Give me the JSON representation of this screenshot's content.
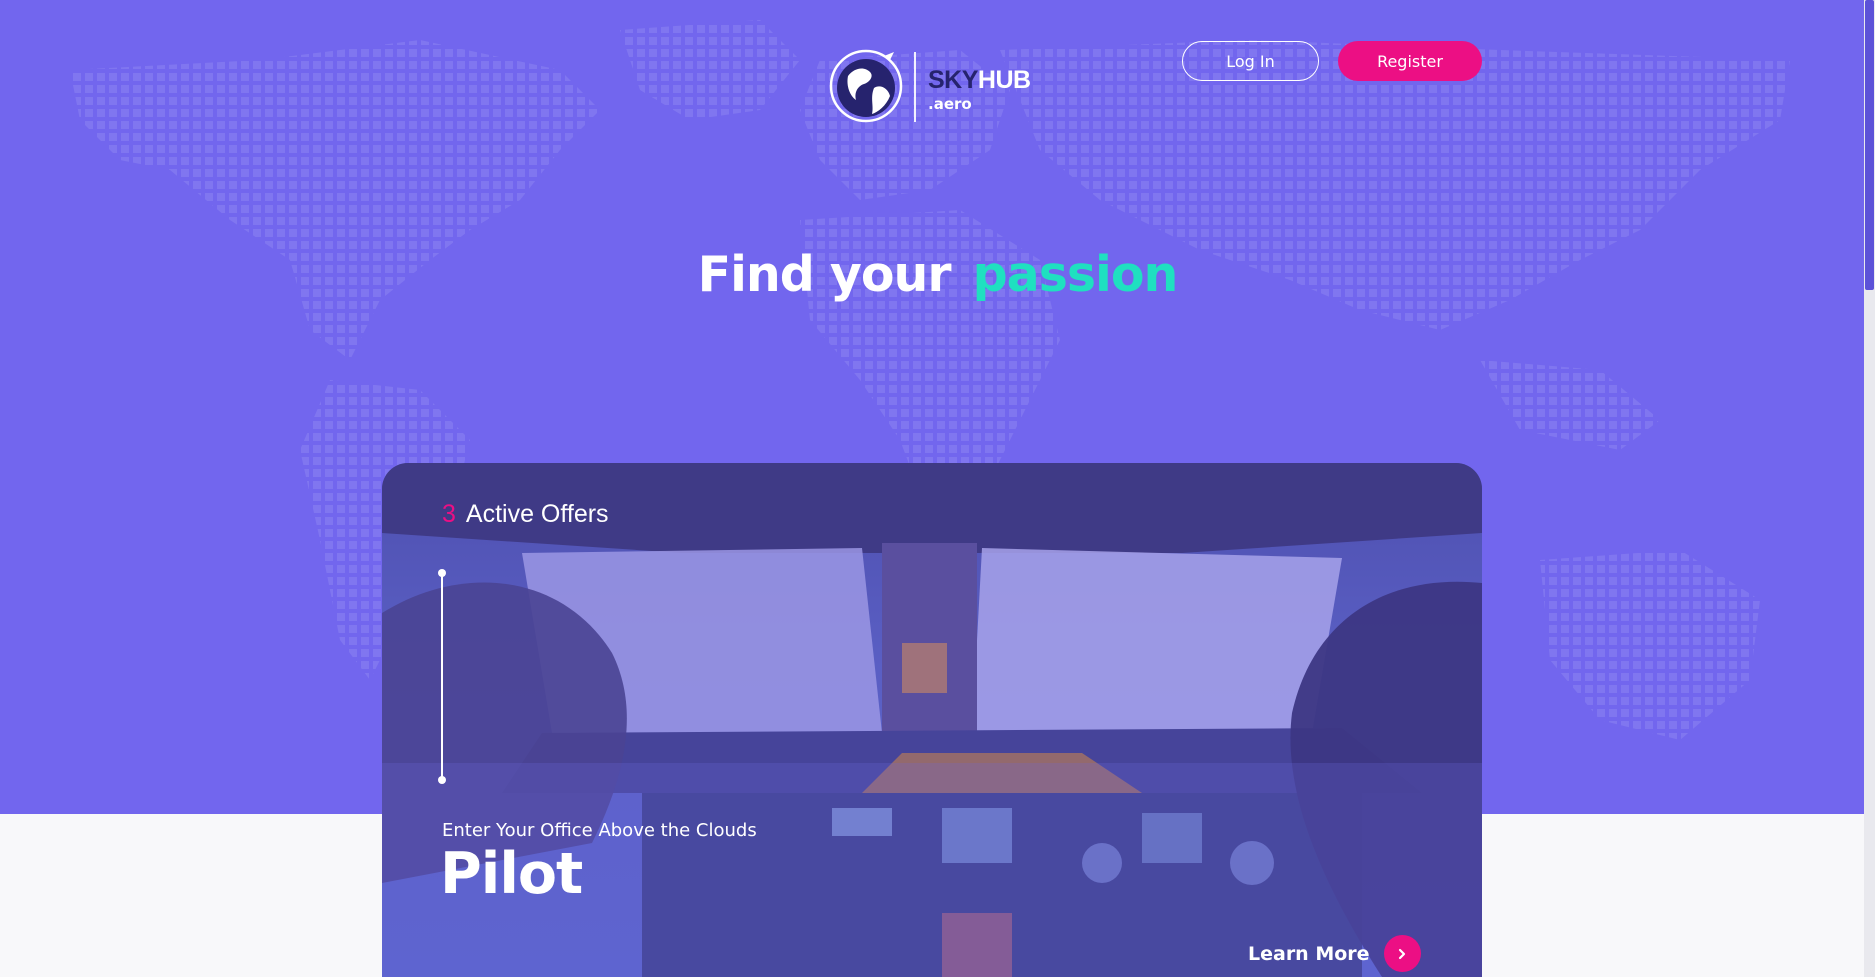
{
  "header": {
    "logo": {
      "sky": "SKY",
      "hub": "HUB",
      "tld": ".aero"
    },
    "login_label": "Log In",
    "register_label": "Register"
  },
  "hero": {
    "headline_prefix": "Find your",
    "headline_highlight": "passion"
  },
  "card": {
    "offers_count": "3",
    "offers_label": "Active Offers",
    "subtitle": "Enter Your Office Above the Clouds",
    "title": "Pilot",
    "learn_more_label": "Learn More"
  },
  "colors": {
    "hero_bg": "#7266ee",
    "accent_pink": "#ec0f84",
    "accent_teal": "#1fe0c0",
    "logo_navy": "#26236e"
  },
  "icons": {
    "logo_mark": "globe-icon",
    "learn_more_arrow": "chevron-right-icon"
  }
}
